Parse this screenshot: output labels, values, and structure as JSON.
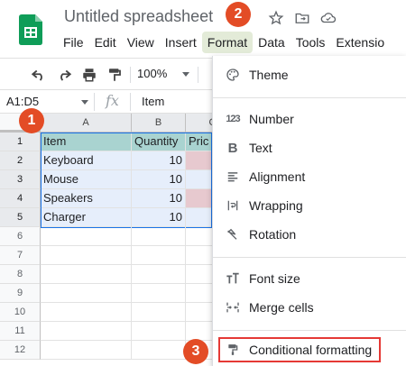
{
  "app": {
    "title": "Untitled spreadsheet"
  },
  "menubar": {
    "items": [
      "File",
      "Edit",
      "View",
      "Insert",
      "Format",
      "Data",
      "Tools",
      "Extensio"
    ]
  },
  "toolbar": {
    "zoom": "100%"
  },
  "formula_bar": {
    "name_box": "A1:D5",
    "fx": "fx",
    "content": "Item"
  },
  "grid": {
    "columns": [
      "A",
      "B",
      "C"
    ],
    "rows": [
      "1",
      "2",
      "3",
      "4",
      "5",
      "6",
      "7",
      "8",
      "9",
      "10",
      "11",
      "12"
    ],
    "cells": [
      [
        "Item",
        "Quantity",
        "Pric"
      ],
      [
        "Keyboard",
        "10",
        "$"
      ],
      [
        "Mouse",
        "10",
        ""
      ],
      [
        "Speakers",
        "10",
        "$"
      ],
      [
        "Charger",
        "10",
        ""
      ]
    ]
  },
  "format_menu": {
    "theme": "Theme",
    "number": "Number",
    "text": "Text",
    "alignment": "Alignment",
    "wrapping": "Wrapping",
    "rotation": "Rotation",
    "font_size": "Font size",
    "merge_cells": "Merge cells",
    "conditional_formatting": "Conditional formatting"
  },
  "callouts": [
    "1",
    "2",
    "3"
  ],
  "colors": {
    "header_fill": "#a9d3d0",
    "band_fill": "#e6eefb",
    "pink_fill": "#e7c9cf",
    "callout": "#e34c26",
    "highlight_border": "#e53935",
    "active_menu": "#e3ebd8"
  }
}
